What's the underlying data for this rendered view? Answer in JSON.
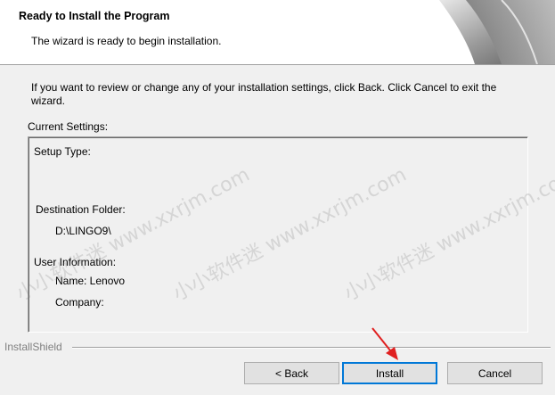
{
  "header": {
    "title": "Ready to Install the Program",
    "subtitle": "The wizard is ready to begin installation."
  },
  "intro": {
    "text": "If you want to review or change any of your installation settings, click Back. Click Cancel to exit the wizard."
  },
  "settings": {
    "label": "Current Settings:",
    "setup_type_label": "Setup Type:",
    "destination_label": "Destination Folder:",
    "destination_value": "D:\\LINGO9\\",
    "user_info_label": "User Information:",
    "name_line": "Name: Lenovo",
    "company_line": "Company:"
  },
  "footer": {
    "brand": "InstallShield"
  },
  "buttons": {
    "back": "< Back",
    "install": "Install",
    "cancel": "Cancel"
  },
  "watermarks": [
    "小小软件迷 www.xxrjm.com",
    "小小软件迷 www.xxrjm.com",
    "小小软件迷 www.xxrjm.com"
  ],
  "colors": {
    "focus_border": "#0078d7",
    "arrow": "#e02020"
  }
}
